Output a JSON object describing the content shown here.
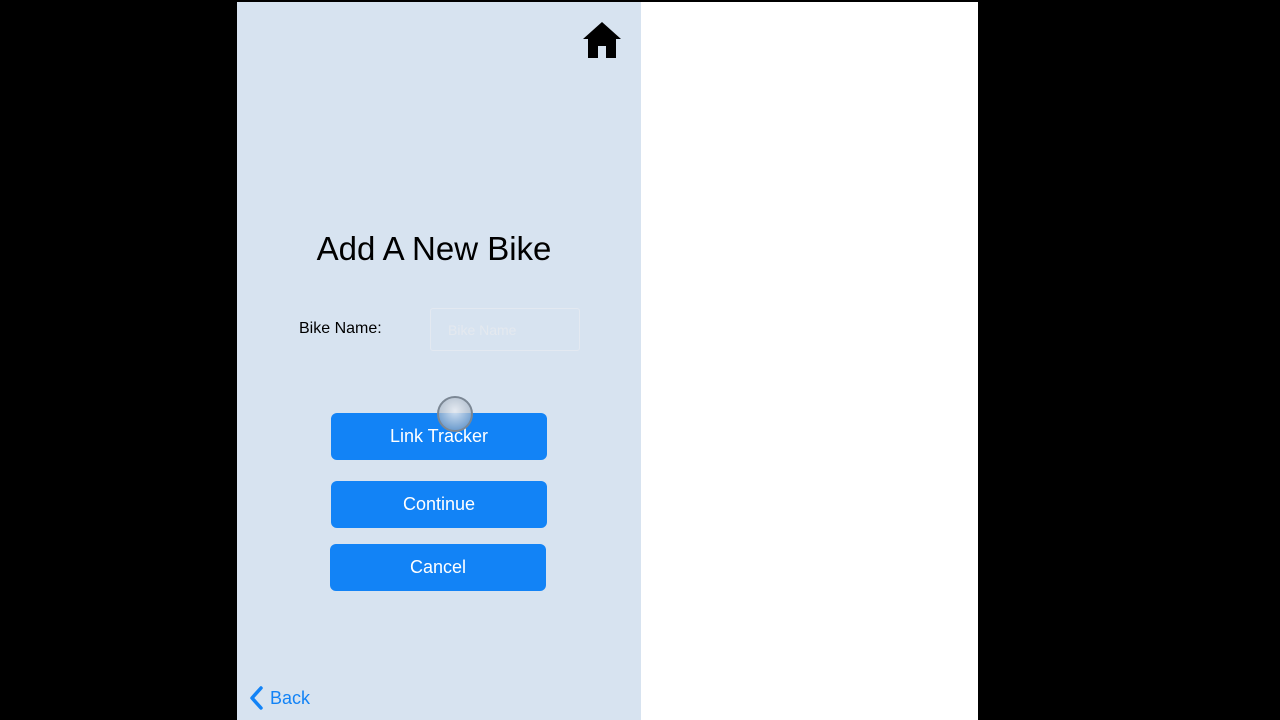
{
  "screen": {
    "title": "Add A New Bike",
    "home_icon": "home-icon"
  },
  "form": {
    "bike_name_label": "Bike Name:",
    "bike_name_value": "",
    "bike_name_placeholder": "Bike Name"
  },
  "buttons": {
    "link_tracker": "Link Tracker",
    "continue": "Continue",
    "cancel": "Cancel"
  },
  "nav": {
    "back_label": "Back",
    "back_icon": "chevron-left-icon"
  },
  "colors": {
    "panel_background": "#d7e3f0",
    "button_blue": "#1283f6",
    "letterbox": "#000000",
    "blank_panel": "#ffffff"
  }
}
